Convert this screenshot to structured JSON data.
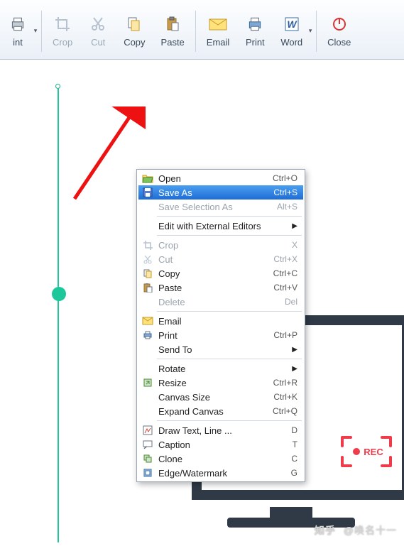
{
  "toolbar": {
    "items": [
      {
        "label": "int",
        "enabled": true,
        "split": true
      },
      {
        "label": "Crop",
        "enabled": false
      },
      {
        "label": "Cut",
        "enabled": false
      },
      {
        "label": "Copy",
        "enabled": true
      },
      {
        "label": "Paste",
        "enabled": true
      },
      {
        "label": "Email",
        "enabled": true
      },
      {
        "label": "Print",
        "enabled": true
      },
      {
        "label": "Word",
        "enabled": true,
        "split": true
      },
      {
        "label": "Close",
        "enabled": true
      }
    ]
  },
  "menu": {
    "items": [
      {
        "icon": "folder-open",
        "label": "Open",
        "shortcut": "Ctrl+O"
      },
      {
        "icon": "save",
        "label": "Save As",
        "shortcut": "Ctrl+S",
        "selected": true
      },
      {
        "icon": "",
        "label": "Save Selection As",
        "shortcut": "Alt+S",
        "disabled": true
      },
      {
        "sep": true
      },
      {
        "icon": "",
        "label": "Edit with External Editors",
        "sub": true
      },
      {
        "sep": true
      },
      {
        "icon": "crop",
        "label": "Crop",
        "shortcut": "X",
        "disabled": true
      },
      {
        "icon": "cut",
        "label": "Cut",
        "shortcut": "Ctrl+X",
        "disabled": true
      },
      {
        "icon": "copy",
        "label": "Copy",
        "shortcut": "Ctrl+C"
      },
      {
        "icon": "paste",
        "label": "Paste",
        "shortcut": "Ctrl+V"
      },
      {
        "icon": "",
        "label": "Delete",
        "shortcut": "Del",
        "disabled": true
      },
      {
        "sep": true
      },
      {
        "icon": "email",
        "label": "Email",
        "shortcut": ""
      },
      {
        "icon": "print",
        "label": "Print",
        "shortcut": "Ctrl+P"
      },
      {
        "icon": "",
        "label": "Send To",
        "sub": true
      },
      {
        "sep": true
      },
      {
        "icon": "",
        "label": "Rotate",
        "sub": true
      },
      {
        "icon": "resize",
        "label": "Resize",
        "shortcut": "Ctrl+R"
      },
      {
        "icon": "",
        "label": "Canvas Size",
        "shortcut": "Ctrl+K"
      },
      {
        "icon": "",
        "label": "Expand Canvas",
        "shortcut": "Ctrl+Q"
      },
      {
        "sep": true
      },
      {
        "icon": "draw",
        "label": "Draw Text, Line ...",
        "shortcut": "D"
      },
      {
        "icon": "caption",
        "label": "Caption",
        "shortcut": "T"
      },
      {
        "icon": "clone",
        "label": "Clone",
        "shortcut": "C"
      },
      {
        "icon": "edge",
        "label": "Edge/Watermark",
        "shortcut": "G"
      }
    ]
  },
  "rec": {
    "label": "REC"
  },
  "watermark": {
    "brand": "知乎",
    "author": "@唤名十一"
  }
}
